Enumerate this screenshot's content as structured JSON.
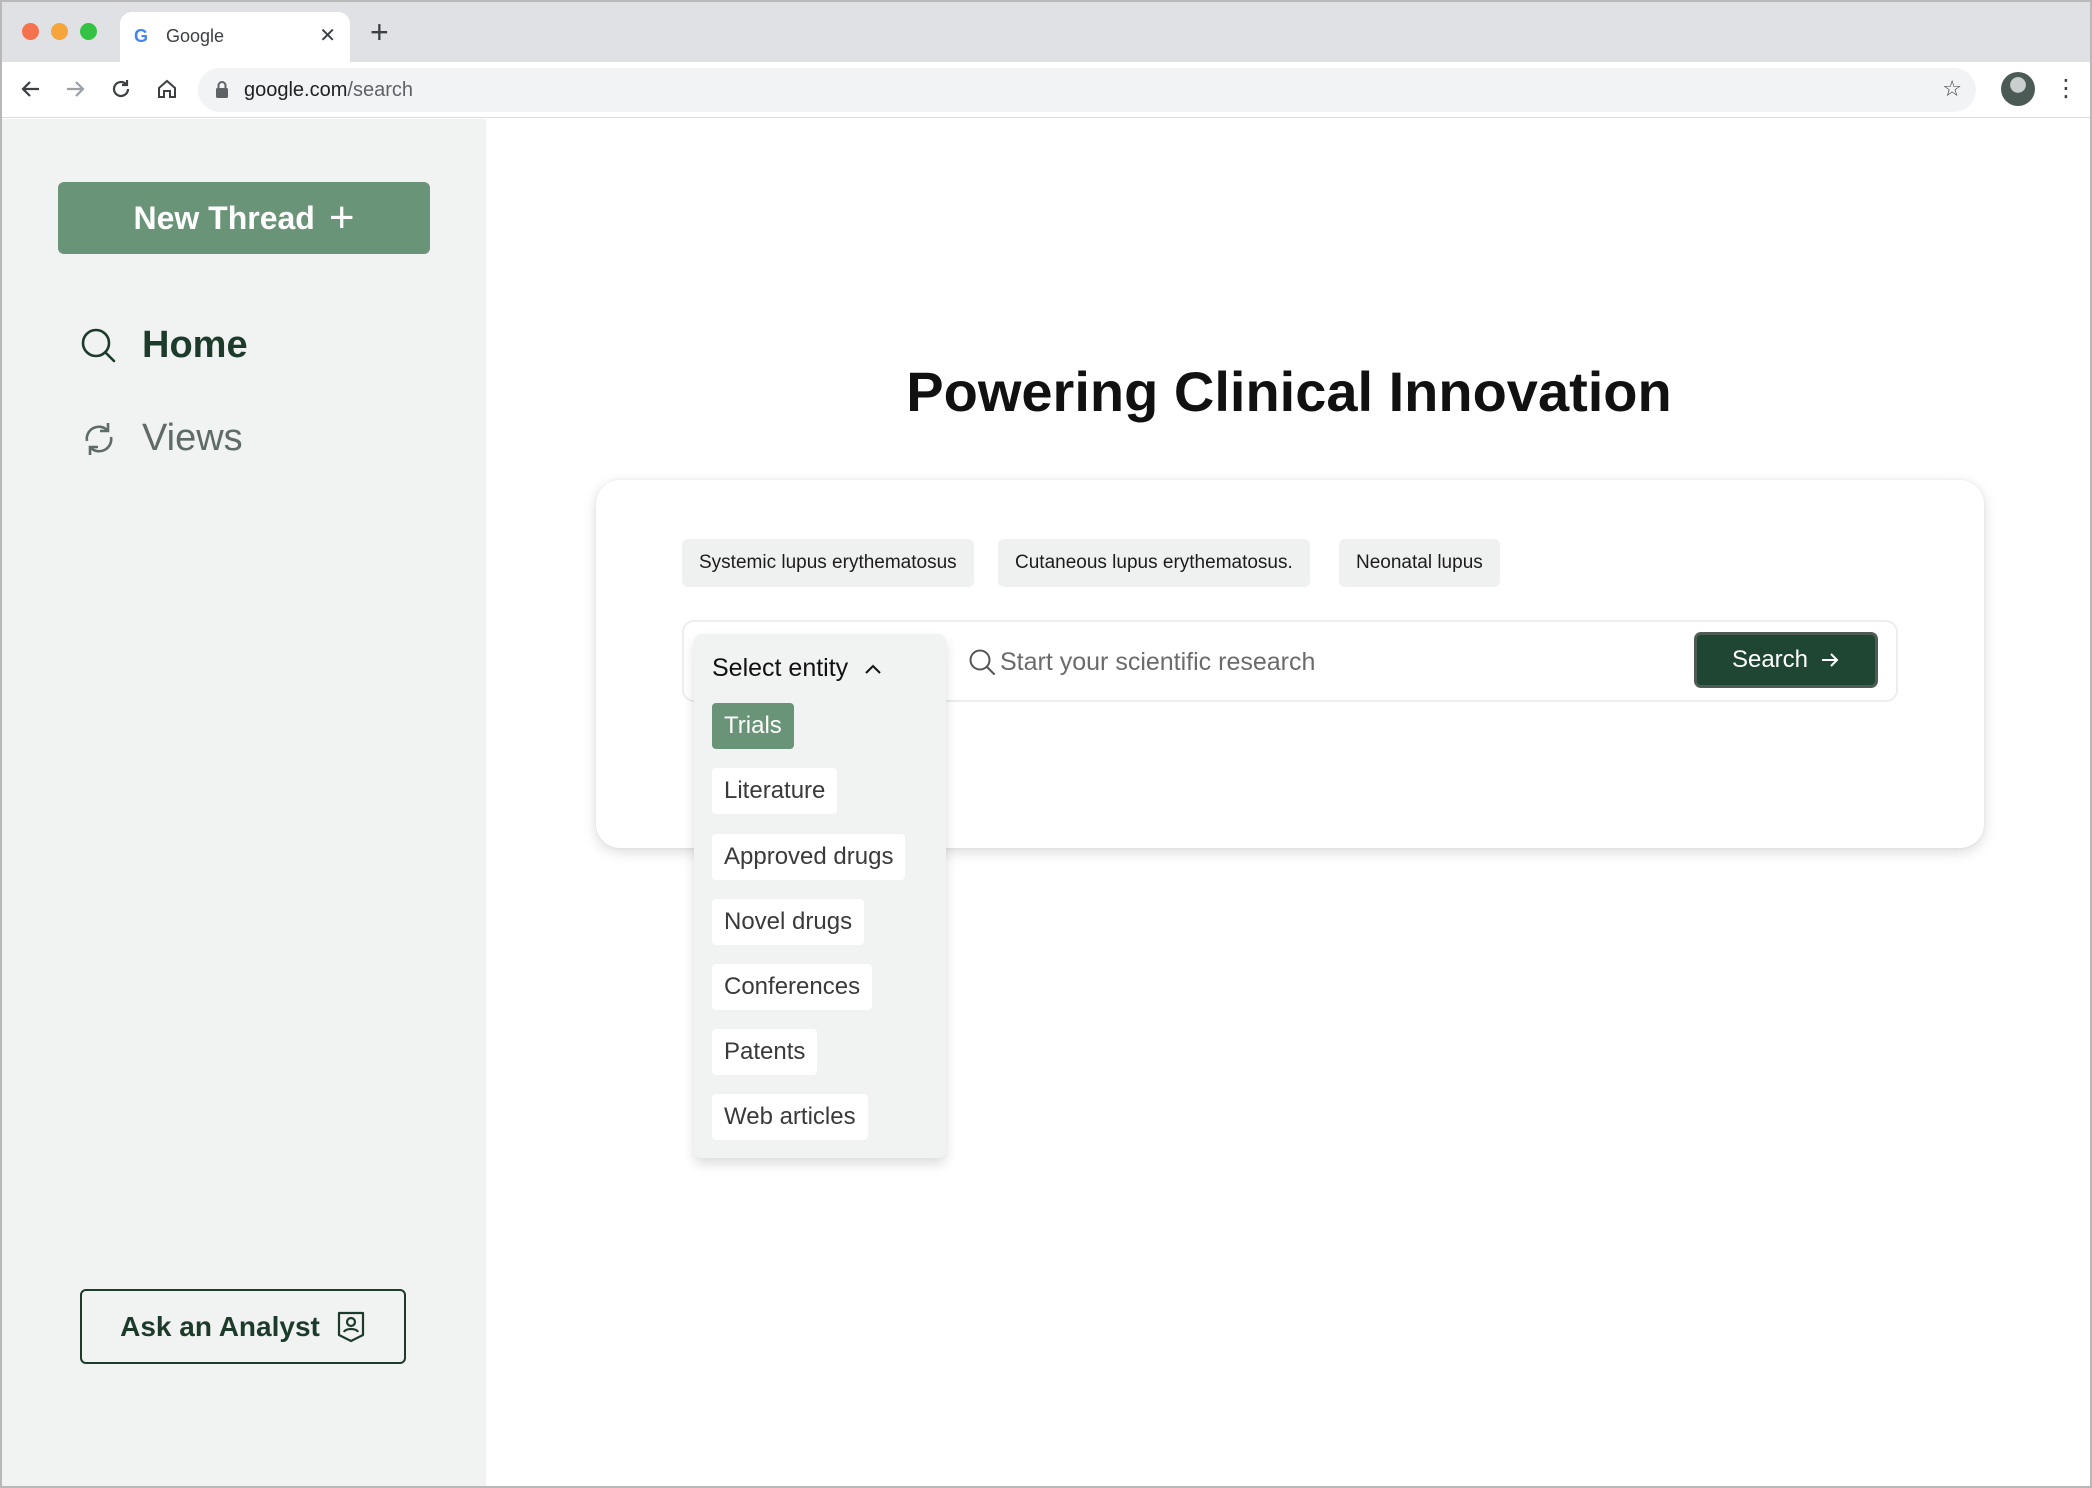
{
  "browser": {
    "tab_title": "Google",
    "url_host": "google.com",
    "url_path": "/search"
  },
  "sidebar": {
    "new_thread_label": "New Thread",
    "nav": [
      {
        "label": "Home",
        "icon": "search-icon",
        "active": true
      },
      {
        "label": "Views",
        "icon": "refresh-icon",
        "active": false
      }
    ],
    "ask_analyst_label": "Ask an Analyst"
  },
  "main": {
    "headline": "Powering Clinical Innovation",
    "suggestion_chips": [
      "Systemic lupus erythematosus",
      "Cutaneous lupus erythematosus.",
      "Neonatal lupus"
    ],
    "search": {
      "placeholder": "Start your scientific research",
      "button_label": "Search"
    },
    "entity_dropdown": {
      "label": "Select entity",
      "expanded": true,
      "selected": "Trials",
      "options": [
        "Trials",
        "Literature",
        "Approved drugs",
        "Novel drugs",
        "Conferences",
        "Patents",
        "Web articles"
      ]
    }
  },
  "colors": {
    "primary_green": "#6a9478",
    "dark_green": "#1e4632",
    "sidebar_bg": "#f1f3f2"
  }
}
